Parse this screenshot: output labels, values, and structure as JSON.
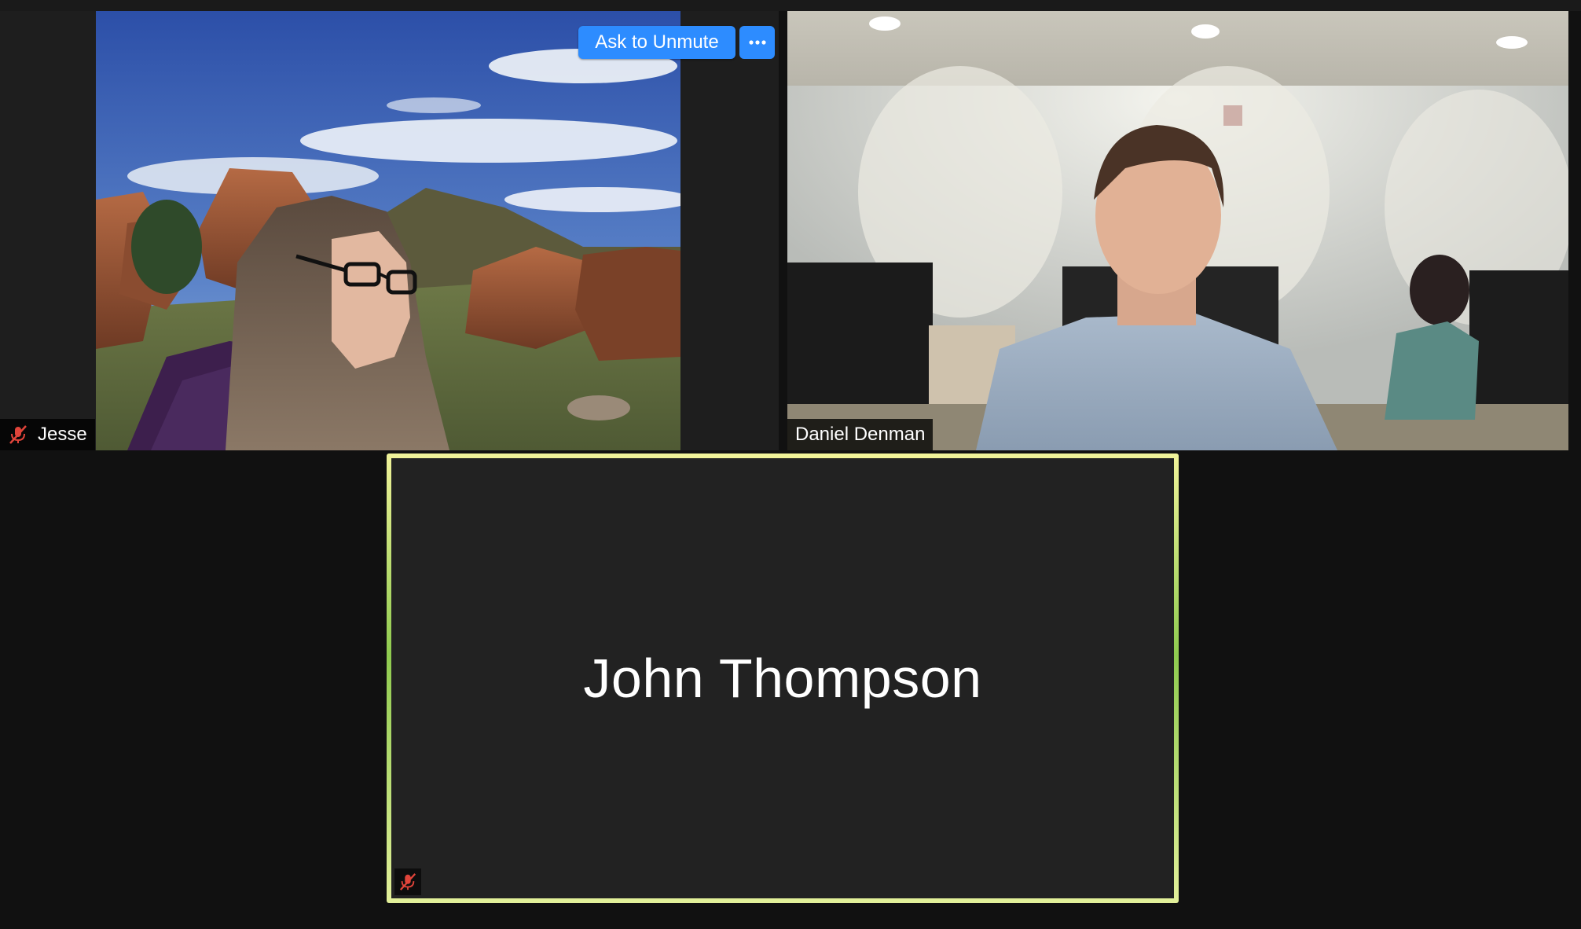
{
  "meeting": {
    "participants": [
      {
        "name": "Jesse",
        "muted": true,
        "video_on": true,
        "background": "mountain-rocks-virtual-background"
      },
      {
        "name": "Daniel Denman",
        "muted": false,
        "video_on": true,
        "background": "office"
      },
      {
        "name": "John Thompson",
        "muted": true,
        "video_on": false,
        "active_speaker": true
      }
    ],
    "hover_controls": {
      "ask_to_unmute_label": "Ask to Unmute",
      "more_icon": "ellipsis-icon"
    }
  },
  "colors": {
    "accent_blue": "#2d8cff",
    "muted_red": "#e0443a",
    "active_speaker_border_top": "#f1f39a",
    "active_speaker_border_mid": "#8fcb4f",
    "tile_background": "#222222",
    "gallery_background": "#111111"
  }
}
